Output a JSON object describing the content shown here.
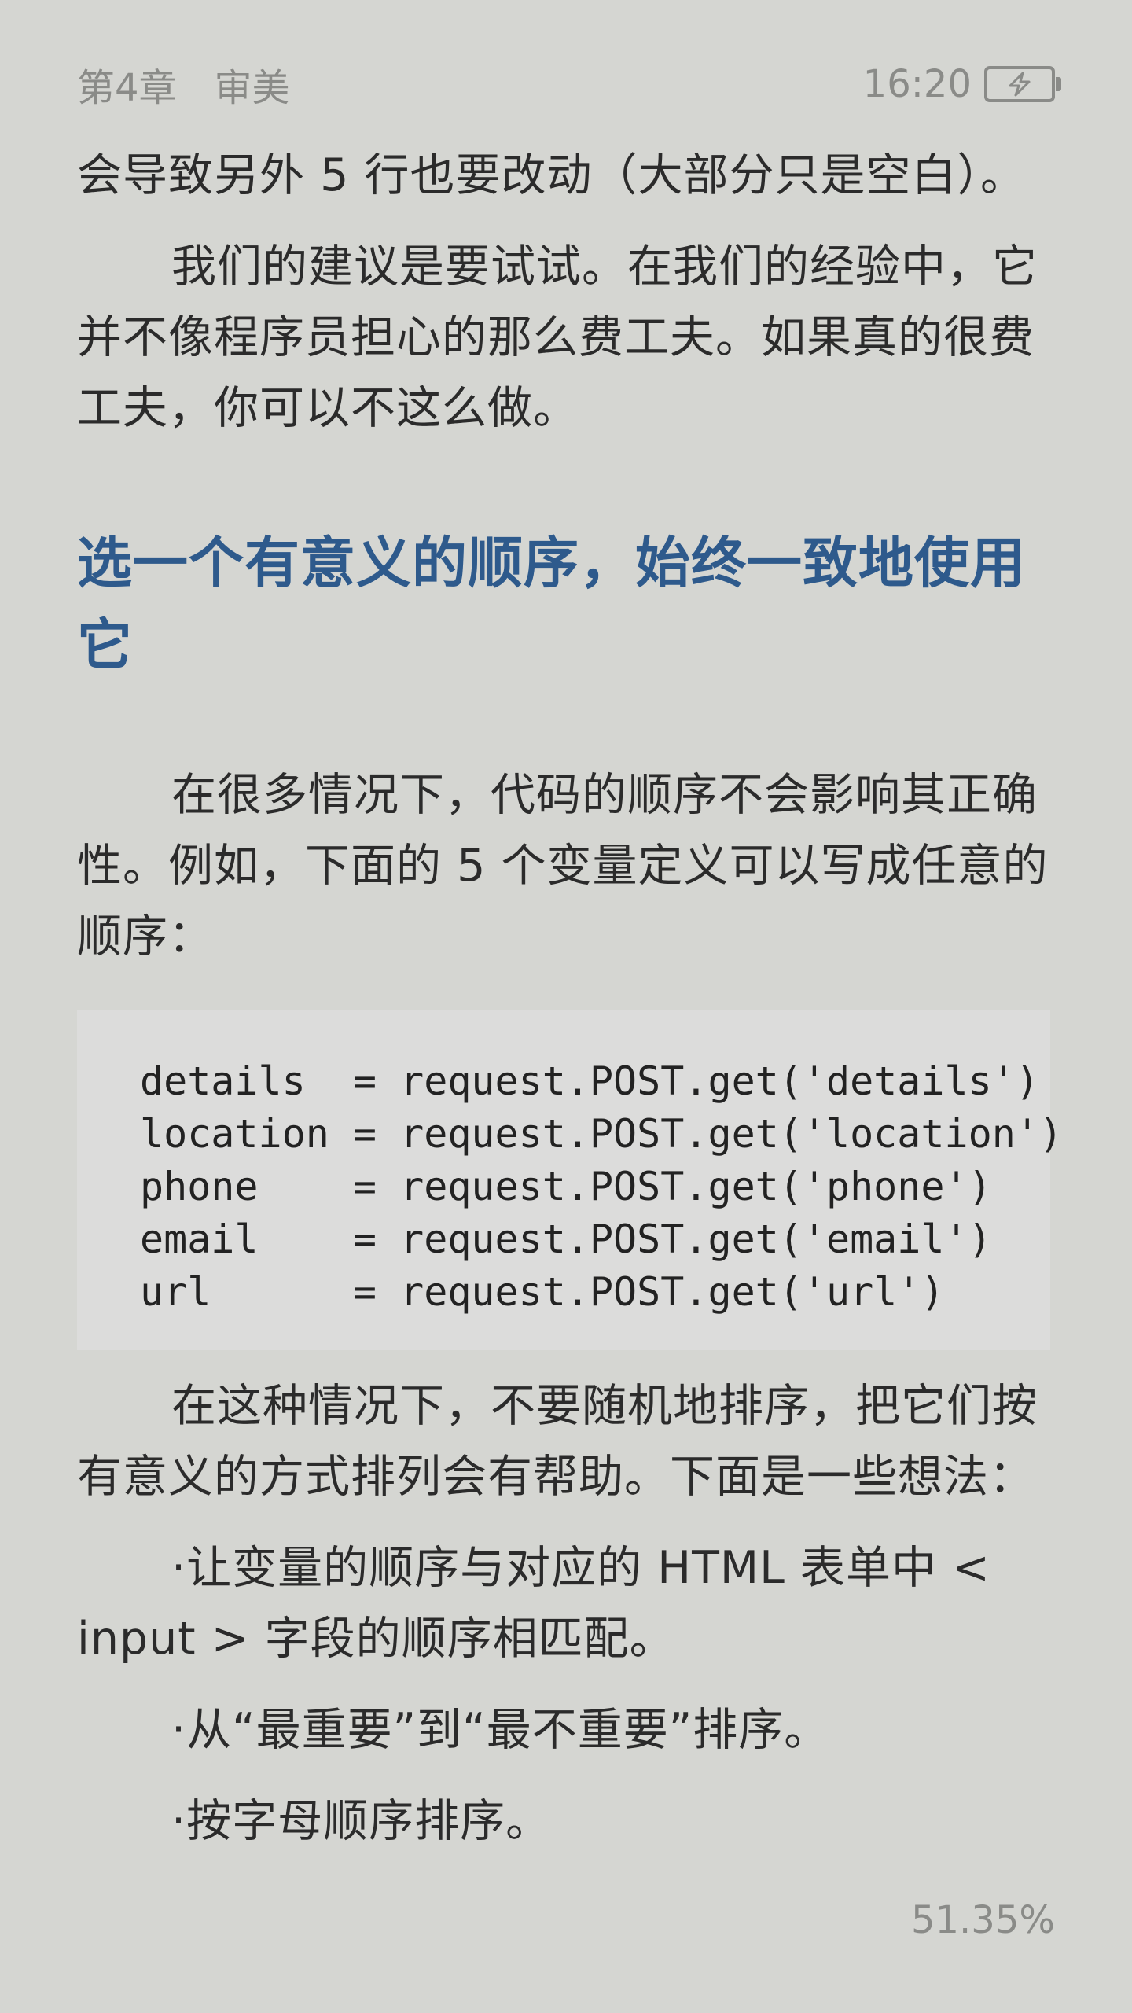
{
  "status_bar": {
    "chapter": "第4章",
    "section": "审美",
    "time": "16:20"
  },
  "content": {
    "para_continuation": "会导致另外 5 行也要改动（大部分只是空白）。",
    "para_suggestion": "我们的建议是要试试。在我们的经验中，它并不像程序员担心的那么费工夫。如果真的很费工夫，你可以不这么做。",
    "heading": "选一个有意义的顺序，始终一致地使用它",
    "para_order_intro": "在很多情况下，代码的顺序不会影响其正确性。例如，下面的 5 个变量定义可以写成任意的顺序：",
    "code_lines": [
      "details  = request.POST.get('details')",
      "location = request.POST.get('location')",
      "phone    = request.POST.get('phone')",
      "email    = request.POST.get('email')",
      "url      = request.POST.get('url')"
    ],
    "para_ideas_intro": "在这种情况下，不要随机地排序，把它们按有意义的方式排列会有帮助。下面是一些想法：",
    "bullets": [
      "·让变量的顺序与对应的 HTML 表单中 < input > 字段的顺序相匹配。",
      "·从“最重要”到“最不重要”排序。",
      "·按字母顺序排序。"
    ]
  },
  "footer": {
    "progress": "51.35%"
  }
}
